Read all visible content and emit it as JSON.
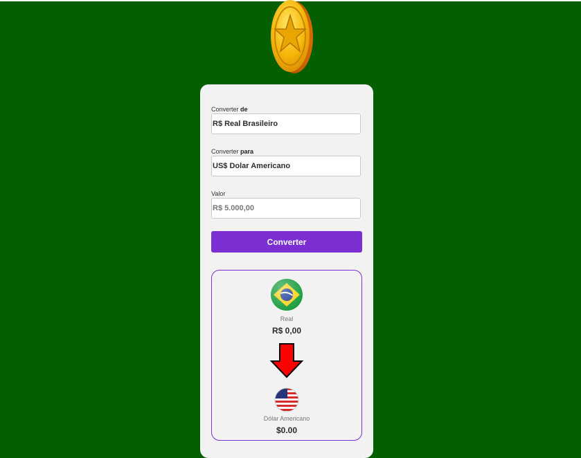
{
  "form": {
    "from": {
      "label_prefix": "Converter",
      "label_strong": "de",
      "value": "R$ Real Brasileiro"
    },
    "to": {
      "label_prefix": "Converter",
      "label_strong": "para",
      "value": "US$ Dolar Americano"
    },
    "amount": {
      "label": "Valor",
      "placeholder": "R$ 5.000,00"
    },
    "convert_label": "Converter"
  },
  "result": {
    "source": {
      "currency": "Real",
      "amount": "R$ 0,00",
      "flag": "brazil-flag-icon"
    },
    "target": {
      "currency": "Dólar Americano",
      "amount": "$0.00",
      "flag": "usa-flag-icon"
    },
    "arrow": "down-arrow-icon"
  },
  "colors": {
    "background": "#045f01",
    "accent": "#7b2fd3",
    "card": "#f2f2f2"
  },
  "icons": {
    "logo": "gold-coin-icon"
  }
}
